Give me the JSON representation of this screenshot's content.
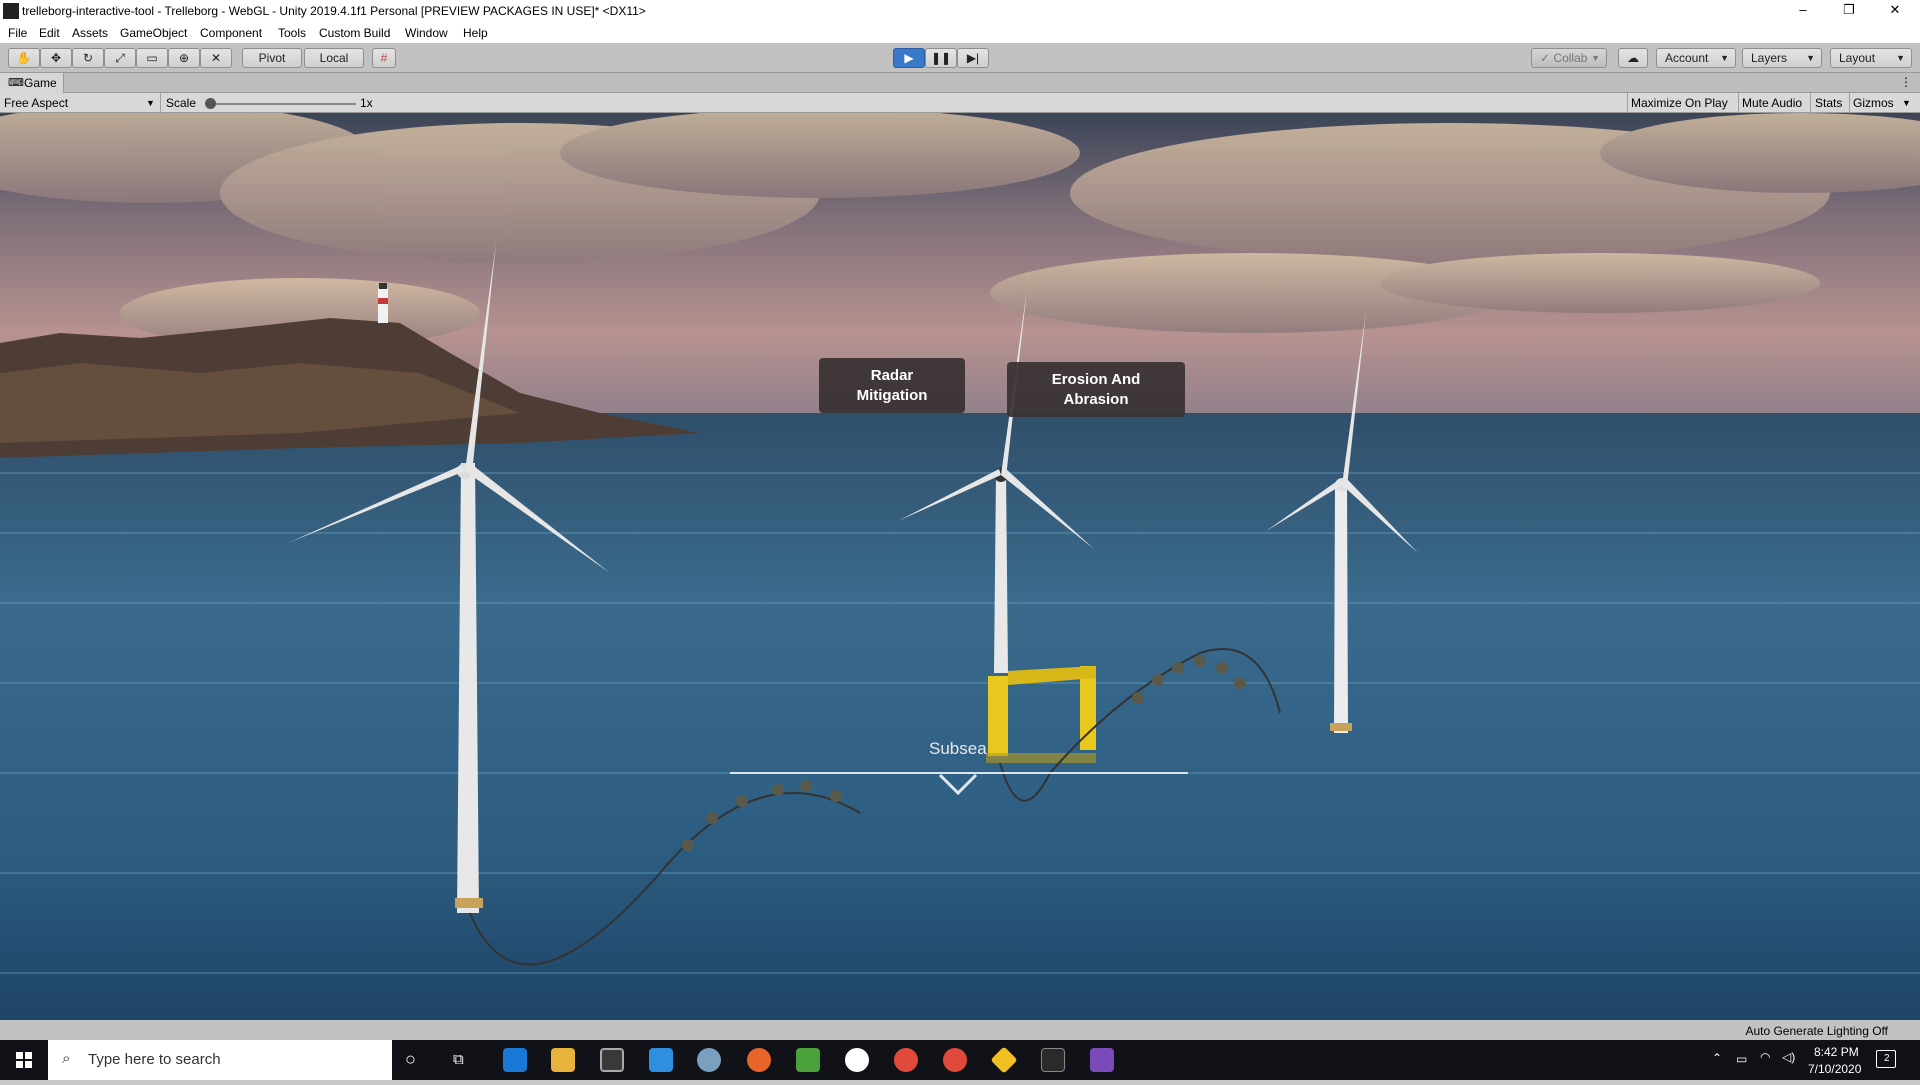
{
  "window": {
    "title": "trelleborg-interactive-tool - Trelleborg - WebGL - Unity 2019.4.1f1 Personal [PREVIEW PACKAGES IN USE]* <DX11>",
    "minimize": "–",
    "restore": "❐",
    "close": "✕"
  },
  "menu": {
    "items": [
      "File",
      "Edit",
      "Assets",
      "GameObject",
      "Component",
      "Tools",
      "Custom Build",
      "Window",
      "Help"
    ]
  },
  "toolbar": {
    "pivot_label": "Pivot",
    "local_label": "Local",
    "collab_label": "Collab",
    "account_label": "Account",
    "layers_label": "Layers",
    "layout_label": "Layout"
  },
  "game_panel": {
    "tab_label": "Game",
    "aspect": "Free Aspect",
    "scale_label": "Scale",
    "scale_value": "1x",
    "maximize_on_play": "Maximize On Play",
    "mute_audio": "Mute Audio",
    "stats": "Stats",
    "gizmos": "Gizmos"
  },
  "scene": {
    "label_radar": "Radar Mitigation",
    "label_erosion": "Erosion And Abrasion",
    "subsea_label": "Subsea"
  },
  "statusbar": {
    "lighting": "Auto Generate Lighting Off"
  },
  "taskbar": {
    "search_placeholder": "Type here to search",
    "time": "8:42 PM",
    "date": "7/10/2020",
    "notification_count": "2"
  },
  "colors": {
    "sky_top": "#3b4456",
    "sea": "#2e5c80",
    "label_bg": "#373032",
    "play_active": "#3a78c9",
    "foundation_yellow": "#e8c81c"
  }
}
